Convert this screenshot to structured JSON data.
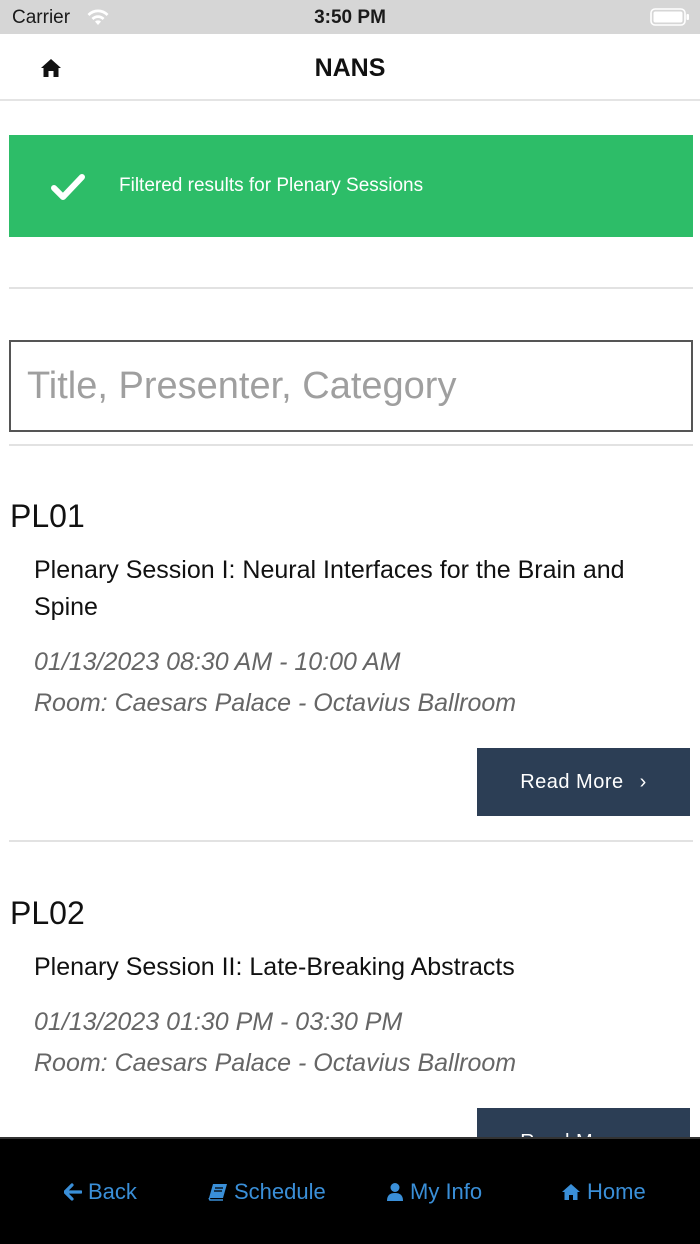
{
  "status_bar": {
    "carrier": "Carrier",
    "time": "3:50 PM"
  },
  "header": {
    "title": "NANS",
    "home_icon": "home-icon"
  },
  "alert": {
    "message": "Filtered results for Plenary Sessions",
    "icon": "check-icon",
    "color": "#2dbd68"
  },
  "search": {
    "placeholder": "Title, Presenter, Category",
    "value": ""
  },
  "sessions": [
    {
      "code": "PL01",
      "title": "Plenary Session I: Neural Interfaces for the Brain and Spine",
      "datetime": "01/13/2023 08:30 AM - 10:00 AM",
      "room": "Room: Caesars Palace - Octavius Ballroom",
      "button_label": "Read More"
    },
    {
      "code": "PL02",
      "title": "Plenary Session II: Late-Breaking Abstracts",
      "datetime": "01/13/2023 01:30 PM - 03:30 PM",
      "room": "Room: Caesars Palace - Octavius Ballroom",
      "button_label": "Read More"
    }
  ],
  "tab_bar": {
    "items": [
      {
        "label": "Back",
        "icon": "arrow-left-icon"
      },
      {
        "label": "Schedule",
        "icon": "book-icon"
      },
      {
        "label": "My Info",
        "icon": "user-icon"
      },
      {
        "label": "Home",
        "icon": "home-icon"
      }
    ],
    "color": "#3a8fd8"
  },
  "colors": {
    "button": "#2c3e55",
    "success": "#2dbd68"
  }
}
